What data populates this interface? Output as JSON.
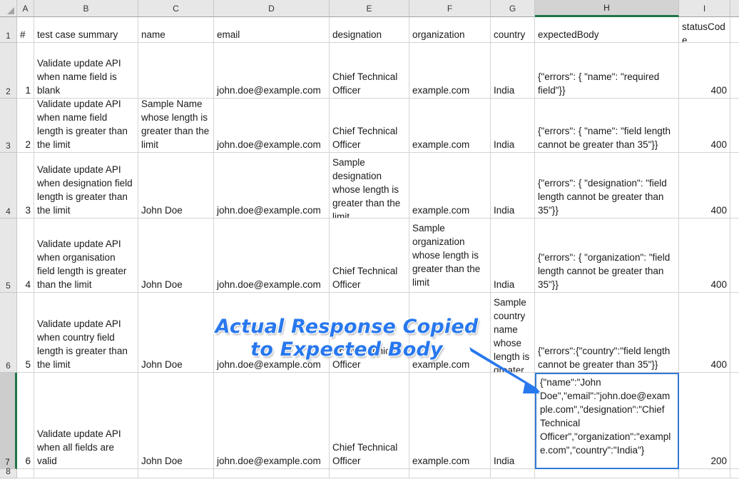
{
  "app": {
    "type": "spreadsheet",
    "selected_column": "H",
    "selected_row": "7",
    "selected_cell": "H7"
  },
  "columns": [
    {
      "letter": "A"
    },
    {
      "letter": "B"
    },
    {
      "letter": "C"
    },
    {
      "letter": "D"
    },
    {
      "letter": "E"
    },
    {
      "letter": "F"
    },
    {
      "letter": "G"
    },
    {
      "letter": "H"
    },
    {
      "letter": "I"
    }
  ],
  "row_numbers": [
    "1",
    "2",
    "3",
    "4",
    "5",
    "6",
    "7",
    "8"
  ],
  "headers": {
    "a": "#",
    "b": "test case summary",
    "c": "name",
    "d": "email",
    "e": "designation",
    "f": "organization",
    "g": "country",
    "h": "expectedBody",
    "i": "statusCode"
  },
  "rows": [
    {
      "num": "1",
      "summary": "Validate update API when name field is blank",
      "name": "",
      "email": "john.doe@example.com",
      "designation": "Chief Technical Officer",
      "organization": "example.com",
      "country": "India",
      "expectedBody": "{\"errors\": { \"name\": \"required field\"}}",
      "statusCode": "400"
    },
    {
      "num": "2",
      "summary": "Validate update API when name field length is greater than the limit",
      "name": "Sample Name whose length is greater than the limit",
      "email": "john.doe@example.com",
      "designation": "Chief Technical Officer",
      "organization": "example.com",
      "country": "India",
      "expectedBody": "{\"errors\": { \"name\": \"field length cannot be greater than 35\"}}",
      "statusCode": "400"
    },
    {
      "num": "3",
      "summary": "Validate update API when designation field length is greater than the limit",
      "name": "John Doe",
      "email": "john.doe@example.com",
      "designation": "Sample designation whose length is greater than the limit",
      "organization": "example.com",
      "country": "India",
      "expectedBody": "{\"errors\": { \"designation\": \"field length cannot be greater than 35\"}}",
      "statusCode": "400"
    },
    {
      "num": "4",
      "summary": "Validate update API when organisation field length is greater than the limit",
      "name": "John Doe",
      "email": "john.doe@example.com",
      "designation": "Chief Technical Officer",
      "organization": "Sample organization whose length is greater than the limit",
      "country": "India",
      "expectedBody": "{\"errors\": { \"organization\": \"field length cannot be greater than 35\"}}",
      "statusCode": "400"
    },
    {
      "num": "5",
      "summary": "Validate update API when country field length is greater than the limit",
      "name": "John Doe",
      "email": "john.doe@example.com",
      "designation": "Chief Technical Officer",
      "organization": "example.com",
      "country": "Sample country name whose length is greater than the limit",
      "expectedBody": "{\"errors\":{\"country\":\"field length cannot be greater than 35\"}}",
      "statusCode": "400"
    },
    {
      "num": "6",
      "summary": "Validate update API when all fields are valid",
      "name": "John Doe",
      "email": "john.doe@example.com",
      "designation": "Chief Technical Officer",
      "organization": "example.com",
      "country": "India",
      "expectedBody": "{\"name\":\"John Doe\",\"email\":\"john.doe@example.com\",\"designation\":\"Chief Technical Officer\",\"organization\":\"example.com\",\"country\":\"India\"}",
      "statusCode": "200"
    }
  ],
  "annotation": {
    "line1": "Actual Response Copied",
    "line2": "to Expected Body",
    "color": "#2878ee",
    "arrow_color": "#2878ee",
    "target_cell": "H7"
  },
  "colors": {
    "header_bg": "#e7e7e7",
    "header_selected_bg": "#d3d3d3",
    "accent_green": "#217346",
    "selection_blue": "#3079d6",
    "grid_line": "#d4d4d4"
  }
}
